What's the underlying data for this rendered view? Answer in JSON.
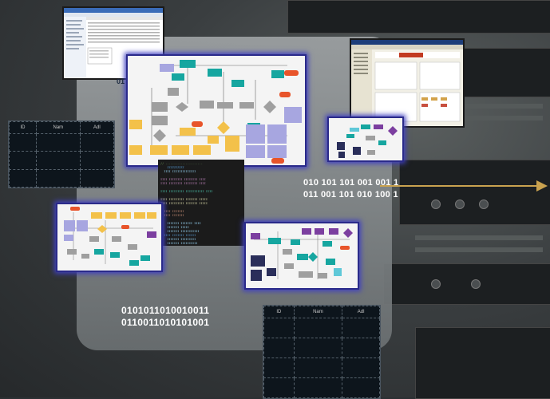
{
  "tables": [
    {
      "headers": [
        "ID",
        "Nam",
        "Adl"
      ]
    },
    {
      "headers": [
        "ID",
        "Nam",
        "Adl"
      ]
    }
  ],
  "binary_right": [
    "010 101 101 001 001 1",
    "011 001 101 010 100 1"
  ],
  "binary_bottom": [
    "0101011010010011",
    "0110011010101001"
  ],
  "label_01": "01",
  "colors": {
    "accent": "#c9a24f",
    "glow": "#4040c0",
    "panel": "#8c9092"
  }
}
